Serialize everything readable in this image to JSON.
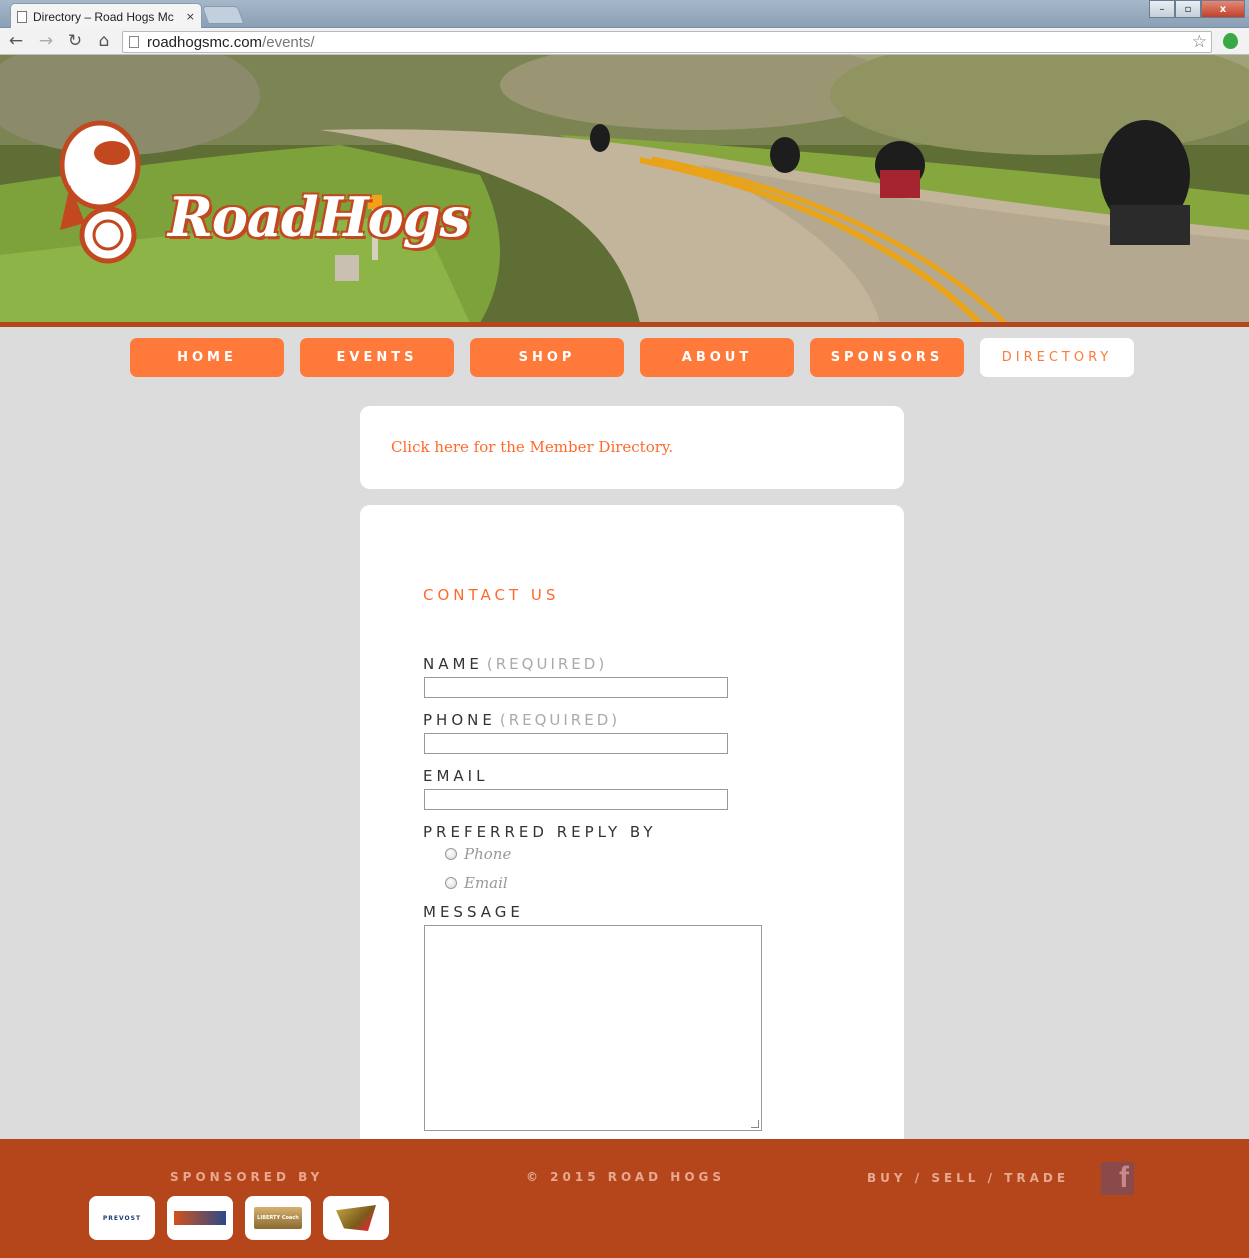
{
  "browser": {
    "tab_title": "Directory – Road Hogs Mc",
    "tab_close": "×",
    "url_host": "roadhogsmc.com",
    "url_path": "/events/",
    "window_minimize": "–",
    "window_maximize": "▫",
    "window_close": "x"
  },
  "icons": {
    "back": "←",
    "forward": "→",
    "reload": "↻",
    "home": "⌂",
    "star": "☆",
    "facebook": "f"
  },
  "brand": {
    "logo_text": "RoadHogs",
    "accent_color": "#ff7a3a",
    "footer_color": "#b5461b"
  },
  "nav": {
    "items": [
      {
        "label": "HOME",
        "active": false
      },
      {
        "label": "EVENTS",
        "active": false
      },
      {
        "label": "SHOP",
        "active": false
      },
      {
        "label": "ABOUT",
        "active": false
      },
      {
        "label": "SPONSORS",
        "active": false
      },
      {
        "label": "DIRECTORY",
        "active": true
      }
    ]
  },
  "directory": {
    "link_text": "Click here for the Member Directory."
  },
  "contact": {
    "title": "CONTACT US",
    "name_label": "NAME",
    "phone_label": "PHONE",
    "required_note": "(REQUIRED)",
    "email_label": "EMAIL",
    "reply_label": "PREFERRED REPLY BY",
    "reply_options": [
      "Phone",
      "Email"
    ],
    "message_label": "MESSAGE"
  },
  "footer": {
    "sponsored_by": "SPONSORED BY",
    "copyright": "© 2015 ROAD HOGS",
    "buy_sell_trade": "BUY / SELL / TRADE",
    "sponsors": [
      {
        "name": "PREVOST"
      },
      {
        "name": ""
      },
      {
        "name": "LIBERTY Coach"
      },
      {
        "name": ""
      }
    ]
  }
}
